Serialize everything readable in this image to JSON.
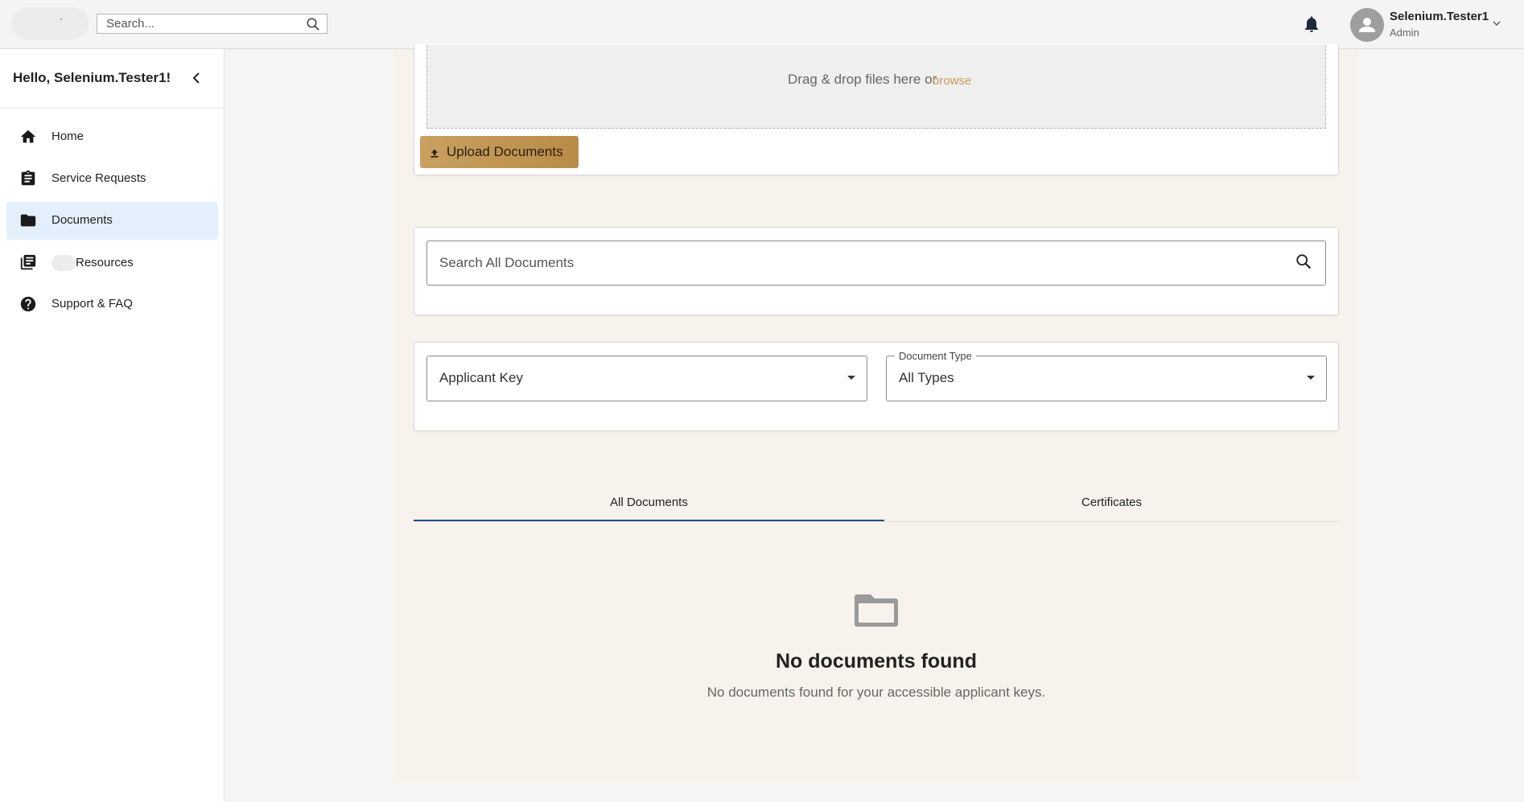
{
  "header": {
    "search_placeholder": "Search...",
    "user_name": "Selenium.Tester1",
    "user_role": "Admin"
  },
  "sidebar": {
    "greeting": "Hello, Selenium.Tester1!",
    "items": [
      {
        "label": "Home",
        "icon": "home-icon",
        "active": false
      },
      {
        "label": "Service Requests",
        "icon": "clipboard-icon",
        "active": false
      },
      {
        "label": "Documents",
        "icon": "folder-icon",
        "active": true
      },
      {
        "label": "Resources",
        "icon": "library-books-icon",
        "active": false
      },
      {
        "label": "Support & FAQ",
        "icon": "help-circle-icon",
        "active": false
      }
    ]
  },
  "upload": {
    "drop_text": "Drag & drop files here or",
    "browse_label": "browse",
    "button_label": "Upload Documents"
  },
  "search": {
    "placeholder": "Search All Documents"
  },
  "filters": {
    "applicant_key_label": "Applicant Key",
    "document_type_label": "Document Type",
    "document_type_value": "All Types"
  },
  "tabs": [
    {
      "label": "All Documents",
      "active": true
    },
    {
      "label": "Certificates",
      "active": false
    }
  ],
  "empty_state": {
    "title": "No documents found",
    "subtitle": "No documents found for your accessible applicant keys."
  },
  "colors": {
    "accent_gold": "#c79a5a",
    "active_nav_bg": "#e3f0fb",
    "tab_underline": "#1f4f8f",
    "content_bg": "#f7f3ec"
  }
}
